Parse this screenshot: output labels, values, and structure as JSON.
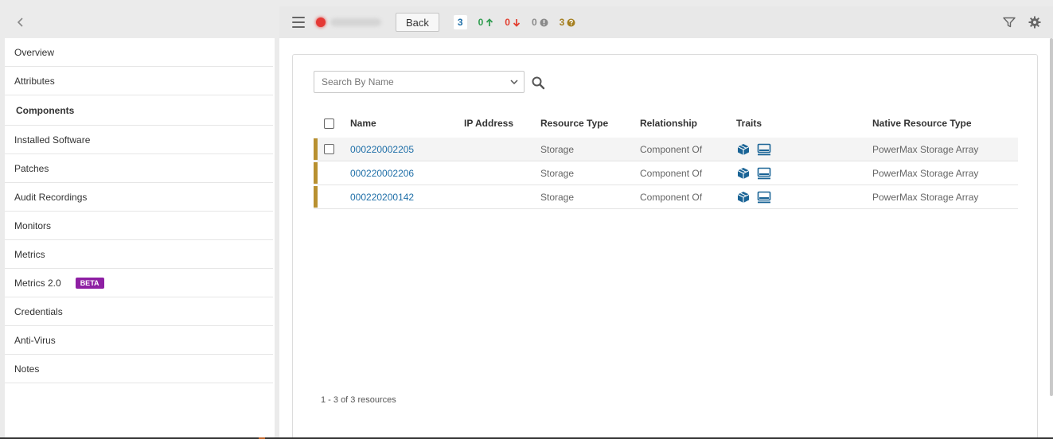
{
  "sidebar": {
    "items": [
      {
        "label": "Overview"
      },
      {
        "label": "Attributes"
      },
      {
        "label": "Components"
      },
      {
        "label": "Installed Software"
      },
      {
        "label": "Patches"
      },
      {
        "label": "Audit Recordings"
      },
      {
        "label": "Monitors"
      },
      {
        "label": "Metrics"
      },
      {
        "label": "Metrics 2.0",
        "badge": "BETA"
      },
      {
        "label": "Credentials"
      },
      {
        "label": "Anti-Virus"
      },
      {
        "label": "Notes"
      }
    ],
    "active": "Components"
  },
  "header": {
    "back_label": "Back",
    "counts": {
      "total": "3",
      "up": "0",
      "down": "0",
      "info": "0",
      "unknown": "3"
    }
  },
  "search": {
    "placeholder": "Search By Name"
  },
  "table": {
    "columns": {
      "name": "Name",
      "ip": "IP Address",
      "resource_type": "Resource Type",
      "relationship": "Relationship",
      "traits": "Traits",
      "native_type": "Native Resource Type"
    },
    "rows": [
      {
        "name": "000220002205",
        "ip": "",
        "resource_type": "Storage",
        "relationship": "Component Of",
        "traits": [
          "box-icon",
          "monitor-icon"
        ],
        "native_type": "PowerMax Storage Array"
      },
      {
        "name": "000220002206",
        "ip": "",
        "resource_type": "Storage",
        "relationship": "Component Of",
        "traits": [
          "box-icon",
          "monitor-icon"
        ],
        "native_type": "PowerMax Storage Array"
      },
      {
        "name": "000220200142",
        "ip": "",
        "resource_type": "Storage",
        "relationship": "Component Of",
        "traits": [
          "box-icon",
          "monitor-icon"
        ],
        "native_type": "PowerMax Storage Array"
      }
    ]
  },
  "pager": {
    "text": "1 - 3 of 3 resources"
  },
  "colors": {
    "link": "#1f6fa8",
    "row_status_bar": "#b89030",
    "beta_badge": "#8e1fa3",
    "up": "#2e9c4e",
    "down": "#e23d2e",
    "unknown": "#a57f20"
  }
}
